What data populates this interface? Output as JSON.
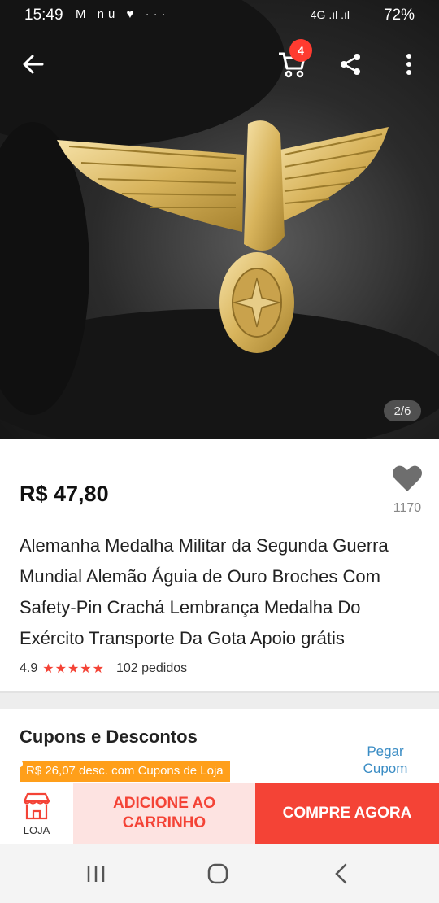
{
  "status_bar": {
    "time": "15:49",
    "notification_icons": "M nu ♥ ···",
    "network": "4G .ıl .ıl",
    "battery": "72%"
  },
  "gallery": {
    "counter": "2/6",
    "cart_badge": "4"
  },
  "product": {
    "price": "R$ 47,80",
    "wishlist_count": "1170",
    "title": "Alemanha Medalha Militar da Segunda Guerra Mundial Alemão Águia de Ouro Broches Com Safety-Pin Crachá Lembrança Medalha Do Exército Transporte Da Gota Apoio grátis",
    "rating": "4.9",
    "stars": "★★★★★",
    "orders": "102 pedidos"
  },
  "coupons": {
    "title": "Cupons e Descontos",
    "tag": "R$ 26,07 desc. com Cupons de Loja",
    "get_coupon": "Pegar Cupom"
  },
  "actions": {
    "store_label": "LOJA",
    "add_to_cart": "ADICIONE AO CARRINHO",
    "buy_now": "COMPRE AGORA"
  },
  "colors": {
    "accent": "#f44336",
    "coupon_tag": "#ff9f1a",
    "link": "#3a8cc4"
  }
}
